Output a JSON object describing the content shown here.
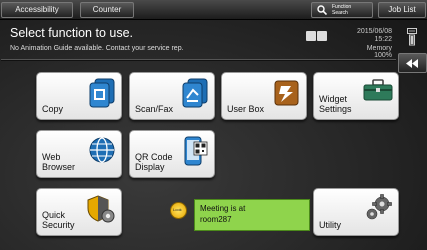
{
  "topbar": {
    "accessibility_label": "Accessibility",
    "counter_label": "Counter",
    "function_search_label_line1": "Function",
    "function_search_label_line2": "Search",
    "job_list_label": "Job List"
  },
  "header": {
    "title": "Select function to use.",
    "subtitle": "No Animation Guide available. Contact your service rep.",
    "date": "2015/06/08",
    "time": "15:22",
    "memory_label": "Memory",
    "memory_value": "100%"
  },
  "tiles": {
    "copy": "Copy",
    "scan_fax": "Scan/Fax",
    "user_box": "User Box",
    "widget_settings_1": "Widget",
    "widget_settings_2": "Settings",
    "web_browser_1": "Web",
    "web_browser_2": "Browser",
    "qr_code_1": "QR Code",
    "qr_code_2": "Display",
    "quick_security_1": "Quick",
    "quick_security_2": "Security",
    "utility": "Utility"
  },
  "message": {
    "line1": "Meeting is at",
    "line2": "room287"
  },
  "colors": {
    "tile_accent": "#1e6eb4",
    "note_background": "#8fd44c",
    "toolbox_green": "#2e7a5a"
  },
  "icons": [
    "magnifier-icon",
    "copy-icon",
    "scan-fax-icon",
    "user-box-icon",
    "toolbox-icon",
    "globe-icon",
    "qr-phone-icon",
    "shield-gear-icon",
    "gear-icon",
    "note-icon",
    "rewind-icon"
  ]
}
